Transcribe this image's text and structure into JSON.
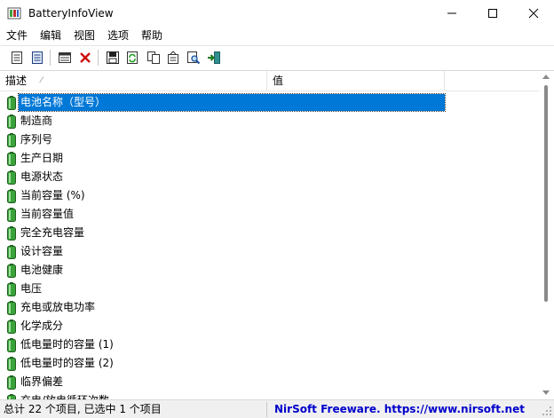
{
  "window": {
    "title": "BatteryInfoView",
    "icon": "battery-app-icon",
    "controls": [
      "minimize-icon",
      "maximize-icon",
      "close-icon"
    ]
  },
  "menu": {
    "items": [
      {
        "label": "文件"
      },
      {
        "label": "编辑"
      },
      {
        "label": "视图"
      },
      {
        "label": "选项"
      },
      {
        "label": "帮助"
      }
    ]
  },
  "toolbar": {
    "buttons": [
      {
        "icon": "properties-icon"
      },
      {
        "icon": "log-icon"
      },
      {
        "icon": "window-icon"
      },
      {
        "icon": "delete-icon"
      },
      {
        "icon": "save-icon"
      },
      {
        "icon": "refresh-icon"
      },
      {
        "icon": "copy-icon"
      },
      {
        "icon": "html-report-icon"
      },
      {
        "icon": "find-icon"
      },
      {
        "icon": "exit-icon"
      }
    ]
  },
  "list": {
    "columns": [
      {
        "label": "描述"
      },
      {
        "label": "值"
      }
    ],
    "sort_indicator": "⁄",
    "rows": [
      {
        "label": "电池名称（型号）",
        "selected": true
      },
      {
        "label": "制造商"
      },
      {
        "label": "序列号"
      },
      {
        "label": "生产日期"
      },
      {
        "label": "电源状态"
      },
      {
        "label": "当前容量 (%)"
      },
      {
        "label": "当前容量值"
      },
      {
        "label": "完全充电容量"
      },
      {
        "label": "设计容量"
      },
      {
        "label": "电池健康"
      },
      {
        "label": "电压"
      },
      {
        "label": "充电或放电功率"
      },
      {
        "label": "化学成分"
      },
      {
        "label": "低电量时的容量 (1)"
      },
      {
        "label": "低电量时的容量 (2)"
      },
      {
        "label": "临界偏差"
      },
      {
        "label": "充电/放电循环次数"
      }
    ]
  },
  "status": {
    "left": "总计 22 个项目, 已选中 1 个项目",
    "right": "NirSoft Freeware. https://www.nirsoft.net"
  },
  "colors": {
    "selection": "#0078d7",
    "battery_green": "#3aa33a",
    "link_blue": "#0000cc"
  }
}
